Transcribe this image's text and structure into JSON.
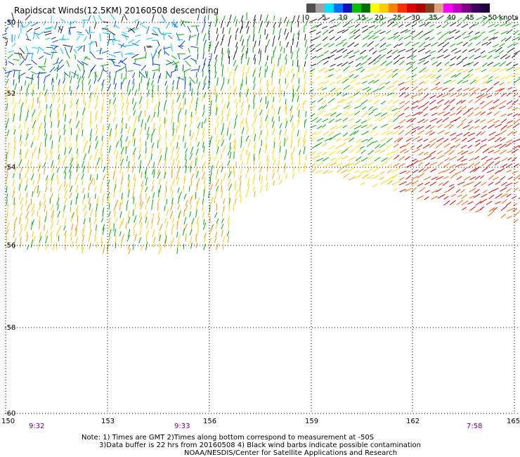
{
  "title": "Rapidscat Winds(12.5KM) 20160508 descending",
  "scale": {
    "colors": [
      "#505050",
      "#a0a0a0",
      "#00e0ff",
      "#0070ff",
      "#1010c0",
      "#00c000",
      "#007000",
      "#ffff00",
      "#ffcc00",
      "#ff8000",
      "#ff3000",
      "#e00000",
      "#b00000",
      "#804020",
      "#e0a080",
      "#ff00ff",
      "#c000c0",
      "#800080",
      "#400060",
      "#200040"
    ],
    "labels": [
      "0",
      "5",
      "10",
      "15",
      "20",
      "25",
      "30",
      "35",
      "40",
      "45",
      ">50 knots"
    ]
  },
  "axes": {
    "lat_labels": [
      "-50",
      "-52",
      "-54",
      "-56",
      "-58",
      "-60"
    ],
    "lon_labels": [
      "150",
      "153",
      "156",
      "159",
      "162",
      "165"
    ],
    "time_labels": [
      "9:32",
      "9:33",
      "7:58"
    ]
  },
  "notes": [
    "Note: 1) Times are GMT 2)Times along bottom correspond to measurement at -50S",
    "3)Data buffer is 22 hrs from 20160508 4) Black wind barbs indicate possible contamination",
    "NOAA/NESDIS/Center for Satellite Applications and Research"
  ]
}
